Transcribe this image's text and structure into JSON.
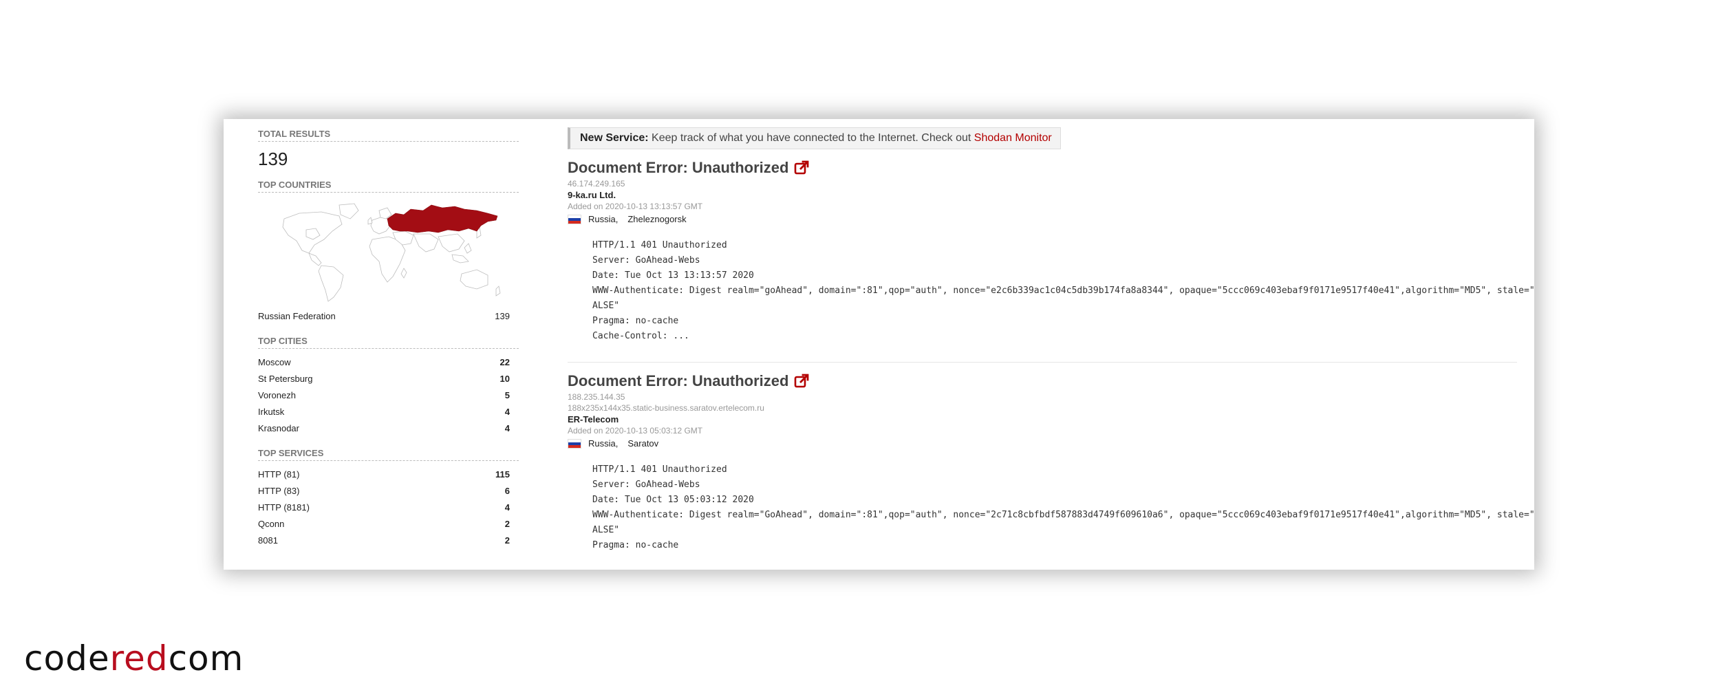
{
  "sidebar": {
    "total_title": "TOTAL RESULTS",
    "total_value": "139",
    "countries_title": "TOP COUNTRIES",
    "countries": [
      {
        "name": "Russian Federation",
        "count": "139"
      }
    ],
    "cities_title": "TOP CITIES",
    "cities": [
      {
        "name": "Moscow",
        "count": "22"
      },
      {
        "name": "St Petersburg",
        "count": "10"
      },
      {
        "name": "Voronezh",
        "count": "5"
      },
      {
        "name": "Irkutsk",
        "count": "4"
      },
      {
        "name": "Krasnodar",
        "count": "4"
      }
    ],
    "services_title": "TOP SERVICES",
    "services": [
      {
        "name": "HTTP (81)",
        "count": "115"
      },
      {
        "name": "HTTP (83)",
        "count": "6"
      },
      {
        "name": "HTTP (8181)",
        "count": "4"
      },
      {
        "name": "Qconn",
        "count": "2"
      },
      {
        "name": "8081",
        "count": "2"
      }
    ]
  },
  "notice": {
    "label": "New Service:",
    "text": " Keep track of what you have connected to the Internet. Check out ",
    "link": "Shodan Monitor"
  },
  "results": [
    {
      "title": "Document Error: Unauthorized",
      "ip": "46.174.249.165",
      "org": "9-ka.ru Ltd.",
      "added": "Added on 2020-10-13 13:13:57 GMT",
      "country": "Russia,",
      "city": "Zheleznogorsk",
      "banner": "HTTP/1.1 401 Unauthorized\nServer: GoAhead-Webs\nDate: Tue Oct 13 13:13:57 2020\nWWW-Authenticate: Digest realm=\"goAhead\", domain=\":81\",qop=\"auth\", nonce=\"e2c6b339ac1c04c5db39b174fa8a8344\", opaque=\"5ccc069c403ebaf9f0171e9517f40e41\",algorithm=\"MD5\", stale=\"F\nALSE\"\nPragma: no-cache\nCache-Control: ..."
    },
    {
      "title": "Document Error: Unauthorized",
      "ip": "188.235.144.35",
      "hostname": "188x235x144x35.static-business.saratov.ertelecom.ru",
      "org": "ER-Telecom",
      "added": "Added on 2020-10-13 05:03:12 GMT",
      "country": "Russia,",
      "city": "Saratov",
      "banner": "HTTP/1.1 401 Unauthorized\nServer: GoAhead-Webs\nDate: Tue Oct 13 05:03:12 2020\nWWW-Authenticate: Digest realm=\"GoAhead\", domain=\":81\",qop=\"auth\", nonce=\"2c71c8cbfbdf587883d4749f609610a6\", opaque=\"5ccc069c403ebaf9f0171e9517f40e41\",algorithm=\"MD5\", stale=\"F\nALSE\"\nPragma: no-cache"
    }
  ],
  "brand": {
    "part1": "code",
    "part2": "red",
    "part3": "com"
  },
  "colors": {
    "accent": "#b30000",
    "map_highlight": "#a30d14",
    "brand_red": "#b80d1e"
  },
  "icons": {
    "external_link": "external-link-icon",
    "flag": "russia-flag-icon",
    "map": "world-map"
  }
}
